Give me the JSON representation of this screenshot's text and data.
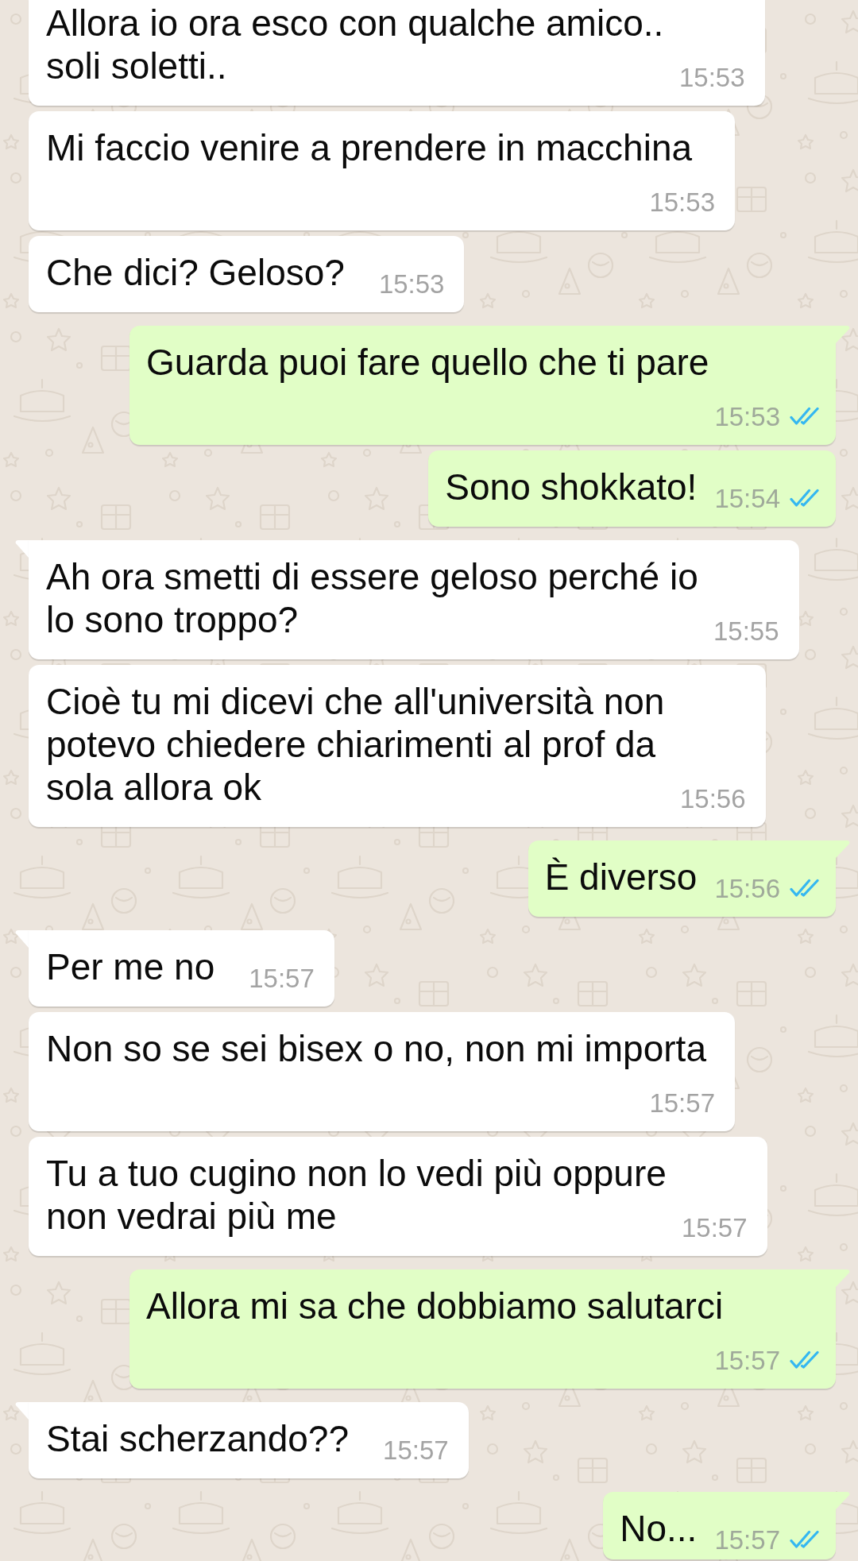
{
  "messages": [
    {
      "kind": "incoming",
      "text": "Allora io ora esco con qualche amico.. soli soletti..",
      "time": "15:53"
    },
    {
      "kind": "incoming",
      "text": "Mi faccio venire a prendere in macchina",
      "time": "15:53"
    },
    {
      "kind": "incoming",
      "text": "Che dici? Geloso?",
      "time": "15:53"
    },
    {
      "kind": "outgoing",
      "text": "Guarda puoi fare quello che ti pare",
      "time": "15:53",
      "read": true
    },
    {
      "kind": "outgoing",
      "text": "Sono shokkato!",
      "time": "15:54",
      "read": true
    },
    {
      "kind": "incoming",
      "text": "Ah ora smetti di essere geloso perché io lo sono troppo?",
      "time": "15:55"
    },
    {
      "kind": "incoming",
      "text": "Cioè tu mi dicevi che all'università non potevo chiedere chiarimenti al prof da sola allora ok",
      "time": "15:56"
    },
    {
      "kind": "outgoing",
      "text": "È diverso",
      "time": "15:56",
      "read": true
    },
    {
      "kind": "incoming",
      "text": "Per me no",
      "time": "15:57"
    },
    {
      "kind": "incoming",
      "text": "Non so se sei bisex o no, non mi importa",
      "time": "15:57"
    },
    {
      "kind": "incoming",
      "text": "Tu a tuo cugino non lo vedi più oppure non vedrai più me",
      "time": "15:57"
    },
    {
      "kind": "outgoing",
      "text": "Allora mi sa che dobbiamo salutarci",
      "time": "15:57",
      "read": true
    },
    {
      "kind": "incoming",
      "text": "Stai scherzando??",
      "time": "15:57"
    },
    {
      "kind": "outgoing",
      "text": "No...",
      "time": "15:57",
      "read": true
    }
  ]
}
